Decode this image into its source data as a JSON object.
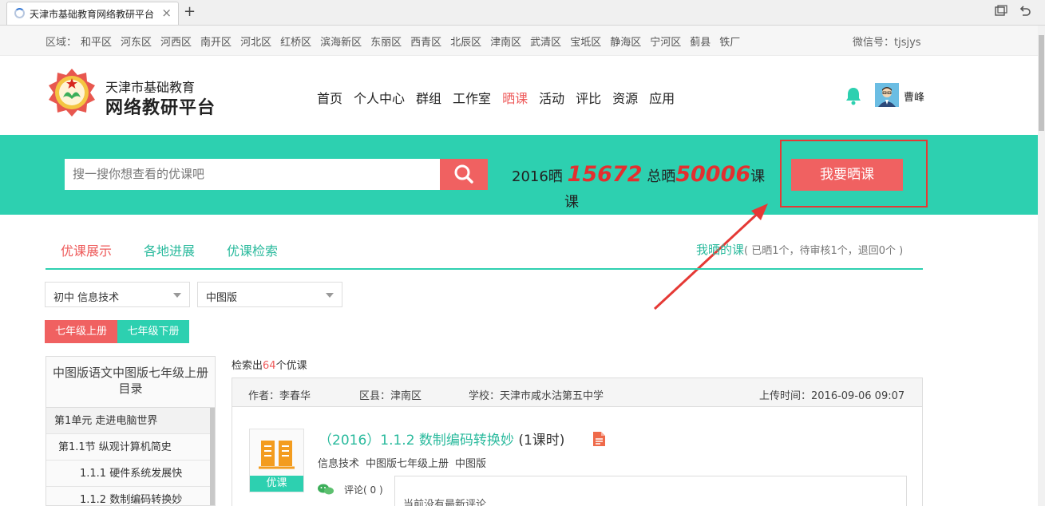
{
  "browser": {
    "tab_title": "天津市基础教育网络教研平台",
    "close_glyph": "×",
    "new_tab_glyph": "+"
  },
  "regionbar": {
    "label": "区域：",
    "regions": [
      "和平区",
      "河东区",
      "河西区",
      "南开区",
      "河北区",
      "红桥区",
      "滨海新区",
      "东丽区",
      "西青区",
      "北辰区",
      "津南区",
      "武清区",
      "宝坻区",
      "静海区",
      "宁河区",
      "蓟县",
      "铁厂"
    ],
    "wechat": "微信号：tjsjys"
  },
  "header": {
    "logo_line1": "天津市基础教育",
    "logo_line2": "网络教研平台",
    "nav": [
      {
        "label": "首页",
        "active": false
      },
      {
        "label": "个人中心",
        "active": false
      },
      {
        "label": "群组",
        "active": false
      },
      {
        "label": "工作室",
        "active": false
      },
      {
        "label": "晒课",
        "active": true
      },
      {
        "label": "活动",
        "active": false
      },
      {
        "label": "评比",
        "active": false
      },
      {
        "label": "资源",
        "active": false
      },
      {
        "label": "应用",
        "active": false
      }
    ],
    "username": "曹峰"
  },
  "banner": {
    "search_placeholder": "搜一搜你想查看的优课吧",
    "stat_prefix": "2016晒",
    "stat_2016": "15672",
    "stat_mid": "总晒",
    "stat_total": "50006",
    "stat_suffix": "课",
    "stat_wrap": "课",
    "share_button": "我要晒课"
  },
  "subtabs": {
    "items": [
      "优课展示",
      "各地进展",
      "优课检索"
    ],
    "my_course": "我晒的课",
    "my_course_info": "( 已晒1个，待审核1个，退回0个 )"
  },
  "filters": {
    "subject": "初中 信息技术",
    "edition": "中图版"
  },
  "grades": [
    "七年级上册",
    "七年级下册"
  ],
  "catalog": {
    "title": "中图版语文中图版七年级上册目录",
    "items": [
      "第1单元 走进电脑世界",
      "第1.1节 纵观计算机简史",
      "1.1.1 硬件系统发展快",
      "1.1.2 数制编码转换妙"
    ]
  },
  "results": {
    "prefix": "检索出",
    "count": "64",
    "suffix": "个优课",
    "card": {
      "author": "作者：李春华",
      "district": "区县：津南区",
      "school": "学校：天津市咸水沽第五中学",
      "upload_time": "上传时间：2016-09-06 09:07",
      "thumb_label": "优课",
      "title": "（2016）1.1.2 数制编码转换妙",
      "lessons": "(1课时)",
      "tags": [
        "信息技术",
        "中图版七年级上册",
        "中图版"
      ],
      "comment_label": "评论( 0 )",
      "comment_text": "当前没有最新评论"
    }
  },
  "colors": {
    "teal": "#2dd0b0",
    "red": "#f06161",
    "highlight": "#e53935"
  }
}
